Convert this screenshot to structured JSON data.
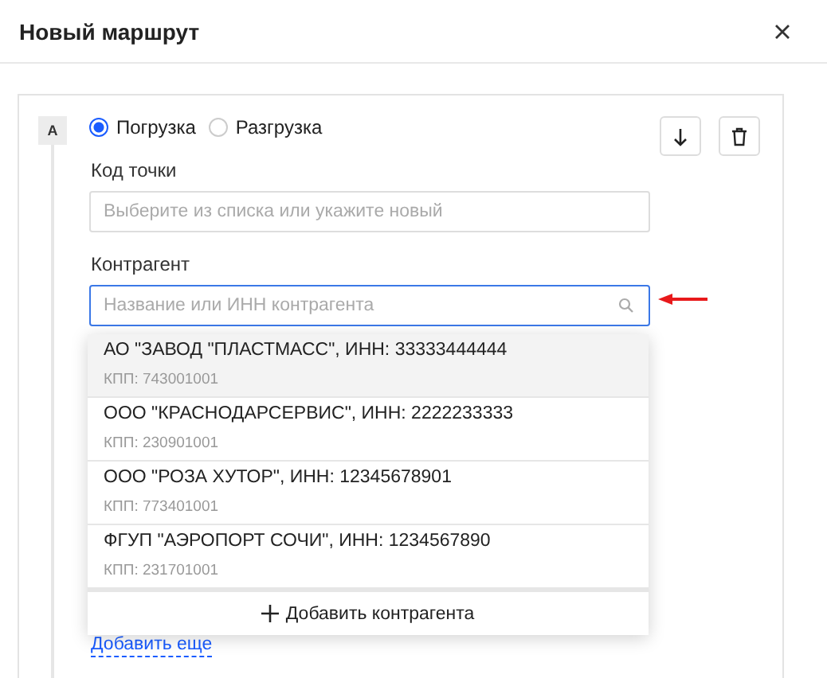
{
  "window": {
    "title": "Новый маршрут"
  },
  "point": {
    "marker": "A",
    "options": [
      {
        "label": "Погрузка",
        "selected": true
      },
      {
        "label": "Разгрузка",
        "selected": false
      }
    ],
    "code_field": {
      "label": "Код точки",
      "placeholder": "Выберите из списка или укажите новый"
    },
    "counterparty_field": {
      "label": "Контрагент",
      "placeholder": "Название или ИНН контрагента",
      "focused": true
    },
    "suggestions": [
      {
        "name": "АО \"ЗАВОД \"ПЛАСТМАСС\", ИНН: 33333444444",
        "kpp": "КПП: 743001001",
        "selected": true
      },
      {
        "name": "ООО \"КРАСНОДАРСЕРВИС\", ИНН: 2222233333",
        "kpp": "КПП: 230901001",
        "selected": false
      },
      {
        "name": "ООО \"РОЗА ХУТОР\", ИНН: 12345678901",
        "kpp": "КПП: 773401001",
        "selected": false
      },
      {
        "name": "ФГУП \"АЭРОПОРТ СОЧИ\", ИНН: 1234567890",
        "kpp": "КПП: 231701001",
        "selected": false
      }
    ],
    "add_counterparty": "Добавить контрагента",
    "add_more": "Добавить еще"
  }
}
